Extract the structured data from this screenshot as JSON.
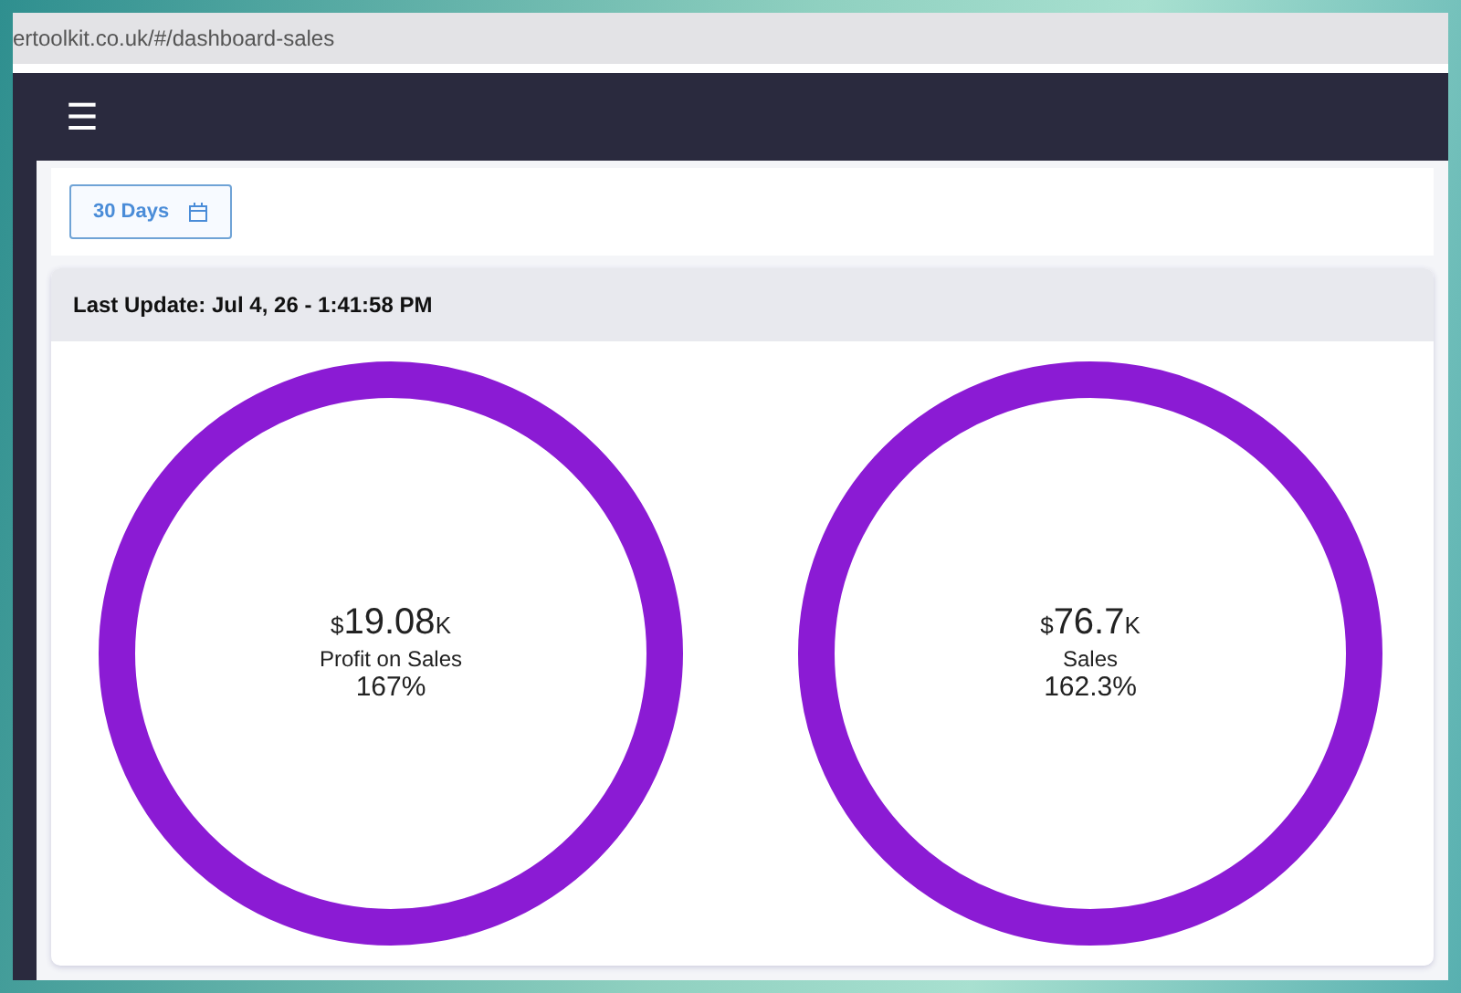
{
  "address_bar": {
    "url": "ertoolkit.co.uk/#/dashboard-sales"
  },
  "navbar": {
    "menu_icon": "☰"
  },
  "date_range": {
    "label": "30 Days"
  },
  "card": {
    "header": "Last Update: Jul 4, 26 - 1:41:58 PM",
    "gauges": [
      {
        "currency": "$",
        "value": "19.08",
        "unit": "K",
        "label": "Profit on Sales",
        "percent": "167%",
        "color": "#8b1bd4"
      },
      {
        "currency": "$",
        "value": "76.7",
        "unit": "K",
        "label": "Sales",
        "percent": "162.3%",
        "color": "#8b1bd4"
      }
    ]
  }
}
